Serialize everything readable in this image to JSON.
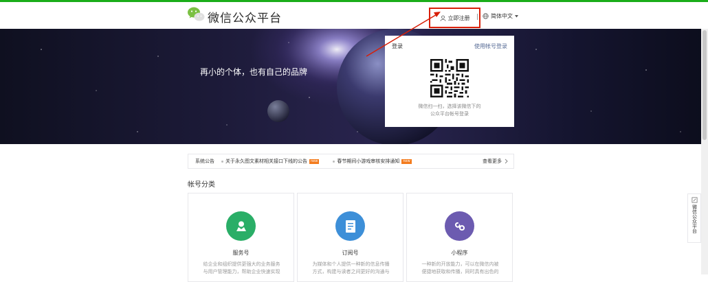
{
  "header": {
    "brand": "微信公众平台",
    "register_label": "立即注册",
    "language_label": "简体中文"
  },
  "banner": {
    "slogan": "再小的个体，也有自己的品牌"
  },
  "login": {
    "title": "登录",
    "alt_login": "使用帐号登录",
    "tip_line1": "微信扫一扫，选择该微信下的",
    "tip_line2": "公众平台帐号登录"
  },
  "notice": {
    "label": "系统公告",
    "items": [
      {
        "text": "关于永久图文素材相关接口下线的公告",
        "badge": "new"
      },
      {
        "text": "春节期间小游戏审核安排通知",
        "badge": "new"
      }
    ],
    "more": "查看更多"
  },
  "account_types": {
    "title": "帐号分类",
    "cards": [
      {
        "title": "服务号",
        "desc_line1": "给企业和组织提供更强大的业务服务",
        "desc_line2": "与用户管理能力，帮助企业快速实现",
        "color": "#2aae67",
        "icon": "user-icon"
      },
      {
        "title": "订阅号",
        "desc_line1": "为媒体和个人提供一种新的信息传播",
        "desc_line2": "方式，构建与读者之间更好的沟通与",
        "color": "#3d8fd8",
        "icon": "document-icon"
      },
      {
        "title": "小程序",
        "desc_line1": "一种新的开放能力，可以在微信内被",
        "desc_line2": "便捷地获取和传播，同时具有出色的",
        "color": "#6c5bb0",
        "icon": "miniprogram-icon"
      }
    ]
  },
  "side_widget": {
    "label": "微信公众平台"
  },
  "colors": {
    "brand_green": "#1aad19",
    "highlight_red": "#d81e06",
    "link_blue": "#576b95"
  }
}
